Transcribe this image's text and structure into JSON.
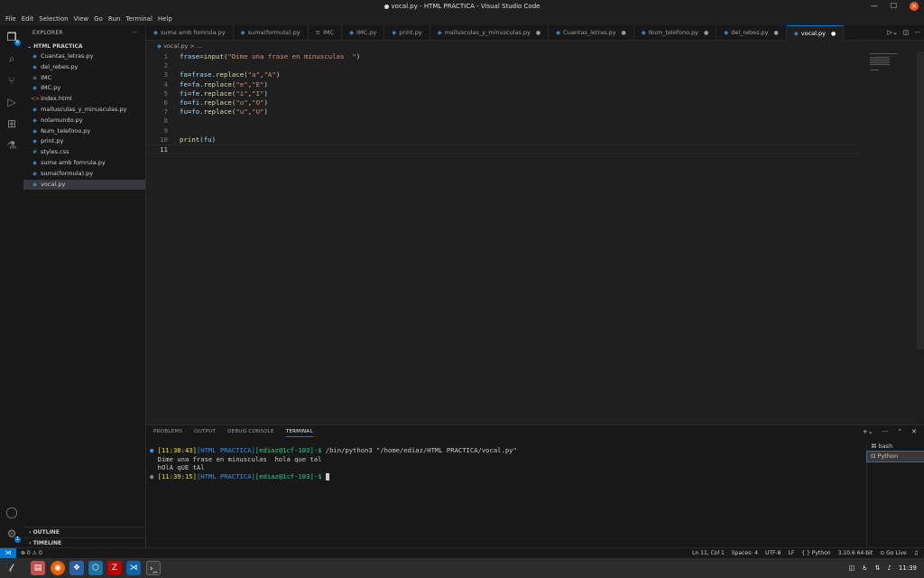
{
  "window": {
    "title": "vocal.py - HTML PRACTICA - Visual Studio Code"
  },
  "menu": [
    "File",
    "Edit",
    "Selection",
    "View",
    "Go",
    "Run",
    "Terminal",
    "Help"
  ],
  "activity": {
    "source_control_badge": "6",
    "accounts_badge": "1"
  },
  "explorer": {
    "header": "EXPLORER",
    "folder": "HTML PRACTICA",
    "files": [
      {
        "name": "Cuantas_letras.py",
        "type": "py"
      },
      {
        "name": "del_rebes.py",
        "type": "py"
      },
      {
        "name": "IMC",
        "type": "txt"
      },
      {
        "name": "IMC.py",
        "type": "py"
      },
      {
        "name": "index.html",
        "type": "html"
      },
      {
        "name": "mallusculas_y_minusculas.py",
        "type": "py"
      },
      {
        "name": "nolamundo.py",
        "type": "py"
      },
      {
        "name": "Num_telefono.py",
        "type": "py"
      },
      {
        "name": "print.py",
        "type": "py"
      },
      {
        "name": "styles.css",
        "type": "css"
      },
      {
        "name": "suma amb fomrula.py",
        "type": "py"
      },
      {
        "name": "suma(formula).py",
        "type": "py"
      },
      {
        "name": "vocal.py",
        "type": "py"
      }
    ],
    "outline": "OUTLINE",
    "timeline": "TIMELINE"
  },
  "tabs": [
    {
      "label": "suma amb fomrula.py"
    },
    {
      "label": "suma(formula).py"
    },
    {
      "label": "IMC"
    },
    {
      "label": "IMC.py"
    },
    {
      "label": "print.py"
    },
    {
      "label": "mallusculas_y_minusculas.py"
    },
    {
      "label": "Cuantas_letras.py"
    },
    {
      "label": "Num_telefono.py"
    },
    {
      "label": "del_rebes.py"
    },
    {
      "label": "vocal.py"
    }
  ],
  "breadcrumb": "vocal.py > ...",
  "code": {
    "line_numbers": [
      "1",
      "2",
      "3",
      "4",
      "5",
      "6",
      "7",
      "8",
      "9",
      "10",
      "11"
    ],
    "l1": {
      "var": "frase",
      "fn": "input",
      "str": "\"Dime una frase en minusculas  \""
    },
    "l3": {
      "a": "fa",
      "b": "frase",
      "fn": "replace",
      "s1": "\"a\"",
      "s2": "\"A\""
    },
    "l4": {
      "a": "fe",
      "b": "fa",
      "fn": "replace",
      "s1": "\"e\"",
      "s2": "\"E\""
    },
    "l5": {
      "a": "fi",
      "b": "fe",
      "fn": "replace",
      "s1": "\"i\"",
      "s2": "\"I\""
    },
    "l6": {
      "a": "fo",
      "b": "fi",
      "fn": "replace",
      "s1": "\"o\"",
      "s2": "\"O\""
    },
    "l7": {
      "a": "fu",
      "b": "fo",
      "fn": "replace",
      "s1": "\"u\"",
      "s2": "\"U\""
    },
    "l10": {
      "fn": "print",
      "var": "fu"
    }
  },
  "panel": {
    "tabs": [
      "PROBLEMS",
      "OUTPUT",
      "DEBUG CONSOLE",
      "TERMINAL"
    ],
    "terminal": {
      "p1_time": "[11:38:43]",
      "p1_dir": "[HTML PRACTICA]",
      "p1_user": "[ediaz@1cf-103]",
      "p1_sign": "-$",
      "p1_cmd": " /bin/python3 \"/home/ediaz/HTML PRACTICA/vocal.py\"",
      "out1": "Dime una frase en minusculas  hola que tal",
      "out2": "hOlA qUE tAl",
      "p2_time": "[11:39:15]",
      "p2_dir": "[HTML PRACTICA]",
      "p2_user": "[ediaz@1cf-103]",
      "p2_sign": "-$"
    },
    "terminals": [
      "bash",
      "Python"
    ]
  },
  "status": {
    "problems": "⊗ 0 ⚠ 0",
    "position": "Ln 11, Col 1",
    "spaces": "Spaces: 4",
    "encoding": "UTF-8",
    "eol": "LF",
    "language": "Python",
    "interpreter": "3.10.6 64-bit",
    "golive": "Go Live"
  },
  "taskbar": {
    "clock": "11:39"
  }
}
